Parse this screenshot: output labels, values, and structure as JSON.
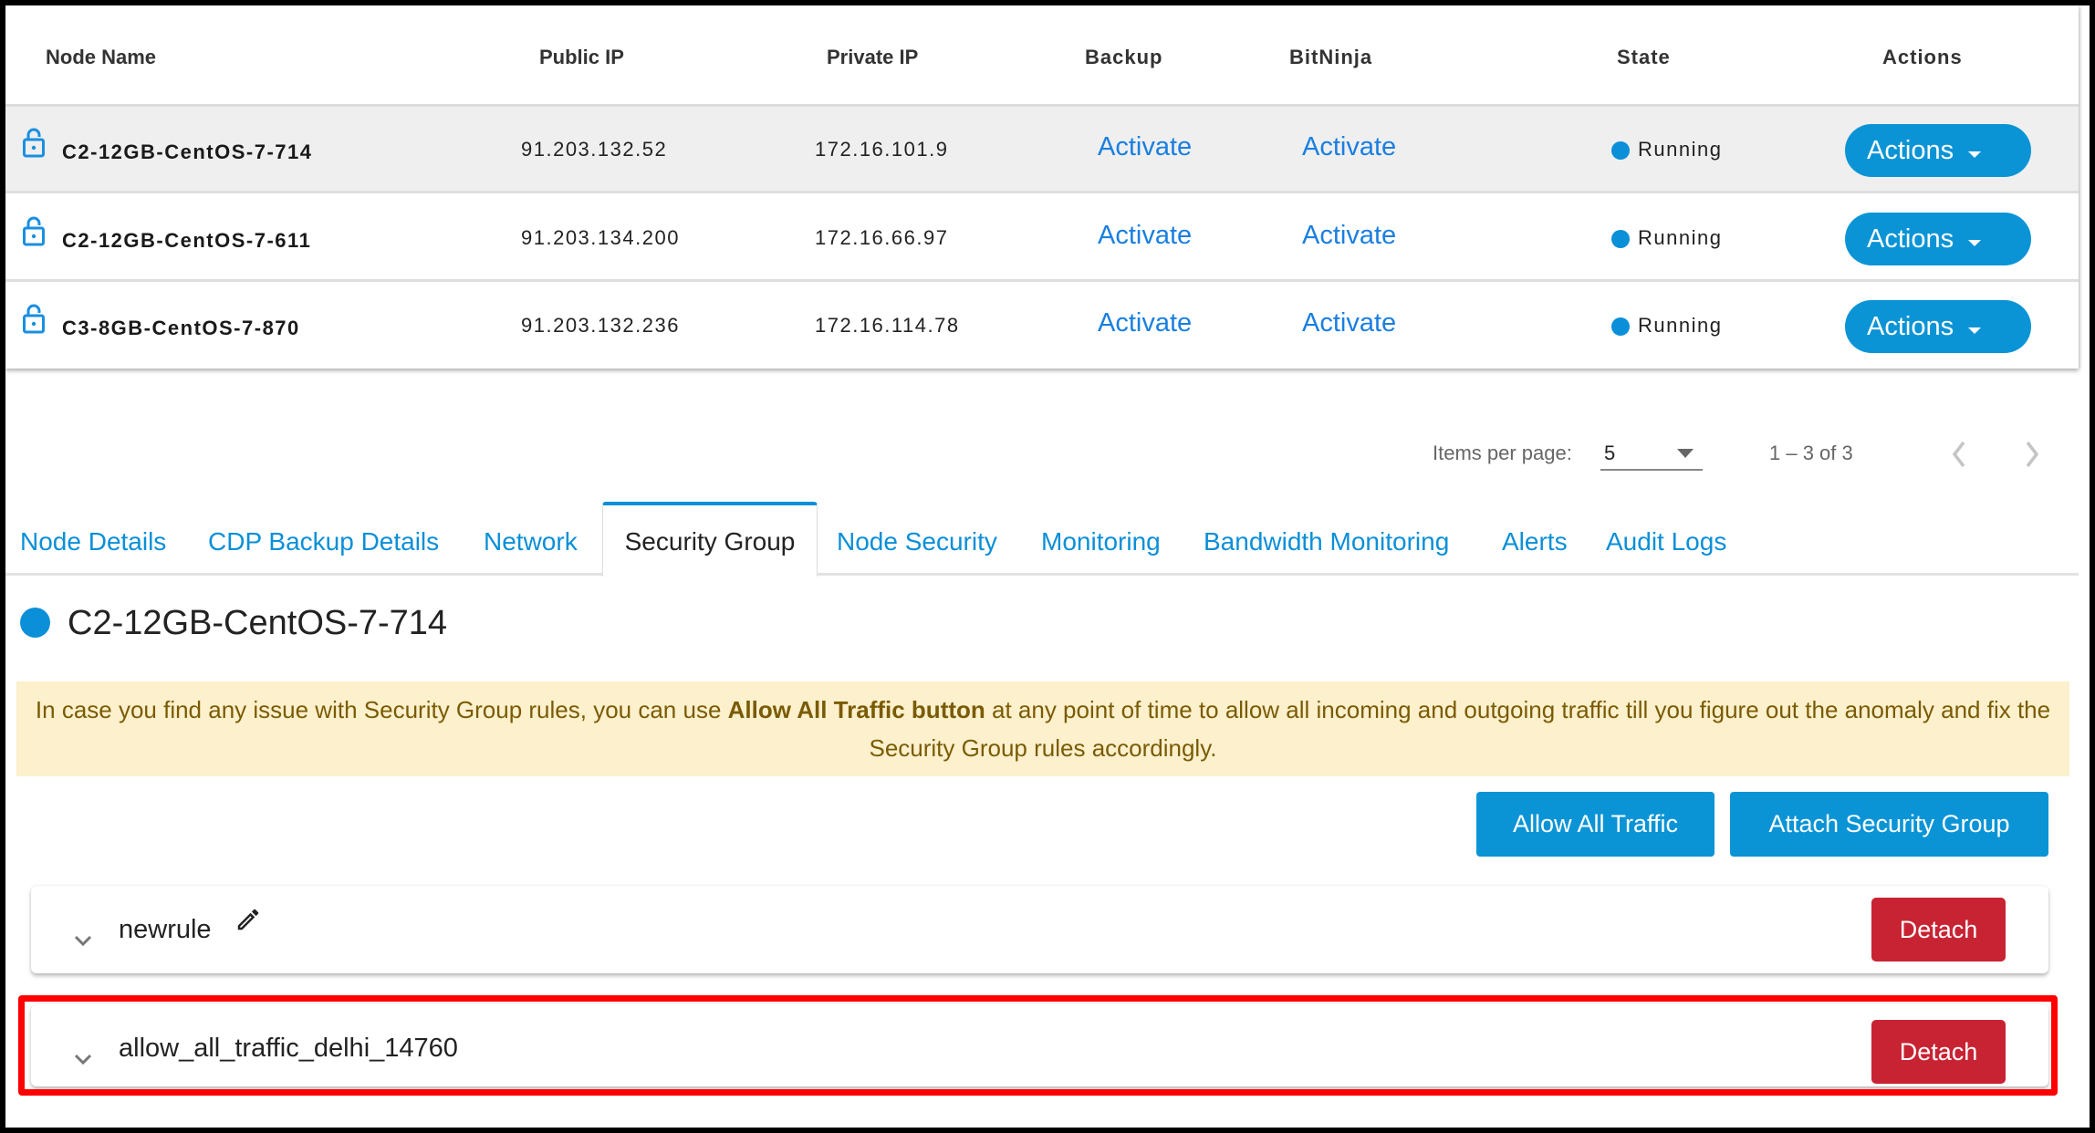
{
  "table": {
    "headers": {
      "node_name": "Node Name",
      "public_ip": "Public IP",
      "private_ip": "Private IP",
      "backup": "Backup",
      "bitninja": "BitNinja",
      "state": "State",
      "actions": "Actions"
    },
    "rows": [
      {
        "name": "C2-12GB-CentOS-7-714",
        "public_ip": "91.203.132.52",
        "private_ip": "172.16.101.9",
        "backup": "Activate",
        "bitninja": "Activate",
        "state": "Running",
        "actions": "Actions",
        "lock_icon": "unlock-icon"
      },
      {
        "name": "C2-12GB-CentOS-7-611",
        "public_ip": "91.203.134.200",
        "private_ip": "172.16.66.97",
        "backup": "Activate",
        "bitninja": "Activate",
        "state": "Running",
        "actions": "Actions",
        "lock_icon": "unlock-icon"
      },
      {
        "name": "C3-8GB-CentOS-7-870",
        "public_ip": "91.203.132.236",
        "private_ip": "172.16.114.78",
        "backup": "Activate",
        "bitninja": "Activate",
        "state": "Running",
        "actions": "Actions",
        "lock_icon": "unlock-icon"
      }
    ]
  },
  "pagination": {
    "items_per_page_label": "Items per page:",
    "items_per_page_value": "5",
    "range": "1 – 3 of 3"
  },
  "tabs": [
    {
      "label": "Node Details"
    },
    {
      "label": "CDP Backup Details"
    },
    {
      "label": "Network"
    },
    {
      "label": "Security Group",
      "active": true
    },
    {
      "label": "Node Security"
    },
    {
      "label": "Monitoring"
    },
    {
      "label": "Bandwidth Monitoring"
    },
    {
      "label": "Alerts"
    },
    {
      "label": "Audit Logs"
    }
  ],
  "node_title": "C2-12GB-CentOS-7-714",
  "alert": {
    "prefix": "In case you find any issue with Security Group rules, you can use ",
    "bold": "Allow All Traffic button",
    "suffix": " at any point of time to allow all incoming and outgoing traffic till you figure out the anomaly and fix the Security Group rules accordingly."
  },
  "buttons": {
    "allow_all": "Allow All Traffic",
    "attach": "Attach Security Group"
  },
  "security_groups": [
    {
      "name": "newrule",
      "editable": true,
      "detach_label": "Detach"
    },
    {
      "name": "allow_all_traffic_delhi_14760",
      "editable": false,
      "detach_label": "Detach",
      "highlighted": true
    }
  ],
  "colors": {
    "primary": "#0a94d6",
    "link": "#1a7fe0",
    "danger": "#c82333",
    "alert_bg": "#fdf0cc",
    "alert_text": "#7a5b05",
    "highlight_border": "#ff0000",
    "running_dot": "#0a8fd8"
  }
}
